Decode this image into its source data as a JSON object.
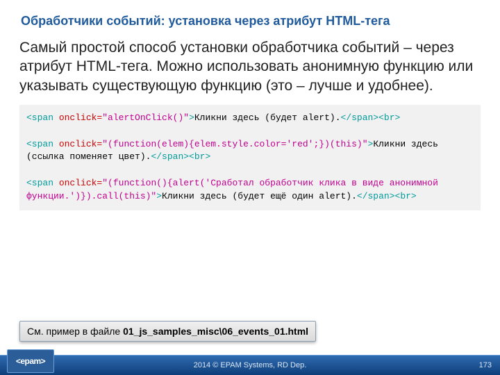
{
  "title": "Обработчики событий: установка через атрибут HTML-тега",
  "paragraph": "Самый простой способ установки обработчика событий – через атрибут HTML-тега. Можно использовать анонимную функцию или указывать существующую функцию (это – лучше и удобнее).",
  "code": {
    "line1": {
      "open1": "<span",
      "attr": " onclick=",
      "str": "\"alertOnClick()\"",
      "close1": ">",
      "text": "Кликни здесь (будет alert).",
      "end": "</span><br>"
    },
    "line2": {
      "open1": "<span",
      "attr": " onclick=",
      "str": "\"(function(elem){elem.style.color='red';})(this)\"",
      "close1": ">",
      "text": "Кликни здесь (ссылка поменяет цвет).",
      "end": "</span><br>"
    },
    "line3": {
      "open1": "<span",
      "attr": " onclick=",
      "str": "\"(function(){alert('Сработал обработчик клика в виде анонимной функции.')}).call(this)\"",
      "close1": ">",
      "text": "Кликни здесь (будет ещё один alert).",
      "end": "</span><br>"
    }
  },
  "note": {
    "prefix": "См. пример в файле ",
    "file": "01_js_samples_misc\\06_events_01.html"
  },
  "footer": {
    "logo": "<epam>",
    "copyright": "2014 © EPAM Systems, RD Dep.",
    "page": "173"
  }
}
